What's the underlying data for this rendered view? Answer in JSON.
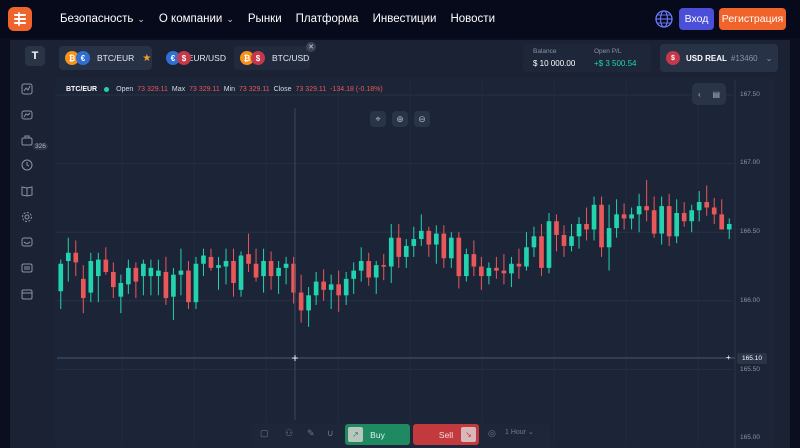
{
  "nav": {
    "items": [
      {
        "label": "Безопасность",
        "dropdown": true
      },
      {
        "label": "О компании",
        "dropdown": true
      },
      {
        "label": "Рынки",
        "dropdown": false
      },
      {
        "label": "Платформа",
        "dropdown": false
      },
      {
        "label": "Инвестиции",
        "dropdown": false
      },
      {
        "label": "Новости",
        "dropdown": false
      }
    ],
    "login_label": "Вход",
    "register_label": "Регистрация",
    "colors": {
      "accent": "#f0632a",
      "login": "#4b4fd8"
    }
  },
  "tabs": [
    {
      "label": "BTC/EUR",
      "favorite": true,
      "active": true
    },
    {
      "label": "EUR/USD",
      "favorite": false,
      "active": false
    },
    {
      "label": "BTC/USD",
      "favorite": false,
      "active": false
    }
  ],
  "account": {
    "balance_label": "Balance",
    "balance_value": "$ 10 000.00",
    "pl_label": "Open P/L",
    "pl_value": "+$ 3 500.54",
    "name": "USD REAL",
    "number": "#13460"
  },
  "sidebar": {
    "badge": "326"
  },
  "chart": {
    "symbol": "BTC/EUR",
    "open_label": "Open",
    "open": "73 329.11",
    "max_label": "Max",
    "max": "73 329.11",
    "min_label": "Min",
    "min": "73 329.11",
    "close_label": "Close",
    "close": "73 329.11",
    "change": "-134.18 (-0.18%)",
    "current_price": "165.10",
    "y_ticks": [
      "167.50",
      "167.00",
      "166.50",
      "166.00",
      "165.50",
      "165.00"
    ]
  },
  "trade": {
    "buy_label": "Buy",
    "sell_label": "Sell",
    "period": "1 Hour"
  },
  "chart_data": {
    "type": "candlestick",
    "ylim": [
      165.0,
      167.5
    ],
    "colors": {
      "up": "#22d3b0",
      "down": "#e8585a"
    },
    "candles": [
      {
        "o": 166.07,
        "h": 166.3,
        "l": 165.94,
        "c": 166.27
      },
      {
        "o": 166.29,
        "h": 166.46,
        "l": 166.14,
        "c": 166.35
      },
      {
        "o": 166.35,
        "h": 166.44,
        "l": 166.18,
        "c": 166.28
      },
      {
        "o": 166.16,
        "h": 166.26,
        "l": 165.91,
        "c": 166.02
      },
      {
        "o": 166.06,
        "h": 166.35,
        "l": 165.99,
        "c": 166.29
      },
      {
        "o": 166.18,
        "h": 166.35,
        "l": 165.99,
        "c": 166.3
      },
      {
        "o": 166.3,
        "h": 166.39,
        "l": 166.19,
        "c": 166.21
      },
      {
        "o": 166.21,
        "h": 166.28,
        "l": 166.02,
        "c": 166.1
      },
      {
        "o": 166.03,
        "h": 166.19,
        "l": 165.91,
        "c": 166.13
      },
      {
        "o": 166.12,
        "h": 166.3,
        "l": 166.05,
        "c": 166.24
      },
      {
        "o": 166.24,
        "h": 166.28,
        "l": 166.02,
        "c": 166.14
      },
      {
        "o": 166.18,
        "h": 166.3,
        "l": 166.04,
        "c": 166.27
      },
      {
        "o": 166.18,
        "h": 166.3,
        "l": 166.04,
        "c": 166.24
      },
      {
        "o": 166.18,
        "h": 166.3,
        "l": 166.04,
        "c": 166.22
      },
      {
        "o": 166.21,
        "h": 166.32,
        "l": 165.97,
        "c": 166.02
      },
      {
        "o": 166.03,
        "h": 166.24,
        "l": 165.86,
        "c": 166.19
      },
      {
        "o": 166.19,
        "h": 166.38,
        "l": 166.04,
        "c": 166.22
      },
      {
        "o": 166.22,
        "h": 166.29,
        "l": 165.94,
        "c": 165.99
      },
      {
        "o": 165.99,
        "h": 166.32,
        "l": 165.94,
        "c": 166.27
      },
      {
        "o": 166.27,
        "h": 166.38,
        "l": 166.18,
        "c": 166.33
      },
      {
        "o": 166.32,
        "h": 166.38,
        "l": 166.22,
        "c": 166.24
      },
      {
        "o": 166.24,
        "h": 166.32,
        "l": 166.08,
        "c": 166.26
      },
      {
        "o": 166.25,
        "h": 166.38,
        "l": 166.12,
        "c": 166.29
      },
      {
        "o": 166.29,
        "h": 166.38,
        "l": 166.03,
        "c": 166.13
      },
      {
        "o": 166.08,
        "h": 166.36,
        "l": 166.03,
        "c": 166.33
      },
      {
        "o": 166.34,
        "h": 166.49,
        "l": 166.21,
        "c": 166.27
      },
      {
        "o": 166.27,
        "h": 166.38,
        "l": 166.14,
        "c": 166.17
      },
      {
        "o": 166.18,
        "h": 166.38,
        "l": 166.06,
        "c": 166.29
      },
      {
        "o": 166.29,
        "h": 166.36,
        "l": 166.08,
        "c": 166.18
      },
      {
        "o": 166.18,
        "h": 166.29,
        "l": 166.05,
        "c": 166.24
      },
      {
        "o": 166.24,
        "h": 166.32,
        "l": 166.12,
        "c": 166.27
      },
      {
        "o": 166.27,
        "h": 166.32,
        "l": 165.98,
        "c": 166.06
      },
      {
        "o": 166.06,
        "h": 166.19,
        "l": 165.84,
        "c": 165.93
      },
      {
        "o": 165.93,
        "h": 166.1,
        "l": 165.81,
        "c": 166.04
      },
      {
        "o": 166.04,
        "h": 166.21,
        "l": 165.97,
        "c": 166.14
      },
      {
        "o": 166.14,
        "h": 166.23,
        "l": 166.0,
        "c": 166.08
      },
      {
        "o": 166.08,
        "h": 166.19,
        "l": 165.94,
        "c": 166.12
      },
      {
        "o": 166.12,
        "h": 166.22,
        "l": 165.92,
        "c": 166.04
      },
      {
        "o": 166.04,
        "h": 166.21,
        "l": 165.97,
        "c": 166.16
      },
      {
        "o": 166.16,
        "h": 166.28,
        "l": 166.05,
        "c": 166.22
      },
      {
        "o": 166.22,
        "h": 166.39,
        "l": 166.14,
        "c": 166.29
      },
      {
        "o": 166.29,
        "h": 166.35,
        "l": 166.11,
        "c": 166.17
      },
      {
        "o": 166.17,
        "h": 166.29,
        "l": 166.05,
        "c": 166.26
      },
      {
        "o": 166.26,
        "h": 166.34,
        "l": 166.15,
        "c": 166.25
      },
      {
        "o": 166.25,
        "h": 166.56,
        "l": 166.13,
        "c": 166.46
      },
      {
        "o": 166.46,
        "h": 166.56,
        "l": 166.24,
        "c": 166.32
      },
      {
        "o": 166.32,
        "h": 166.45,
        "l": 166.24,
        "c": 166.4
      },
      {
        "o": 166.4,
        "h": 166.54,
        "l": 166.32,
        "c": 166.45
      },
      {
        "o": 166.45,
        "h": 166.63,
        "l": 166.4,
        "c": 166.51
      },
      {
        "o": 166.51,
        "h": 166.54,
        "l": 166.32,
        "c": 166.41
      },
      {
        "o": 166.41,
        "h": 166.55,
        "l": 166.27,
        "c": 166.49
      },
      {
        "o": 166.49,
        "h": 166.55,
        "l": 166.24,
        "c": 166.31
      },
      {
        "o": 166.31,
        "h": 166.5,
        "l": 166.24,
        "c": 166.46
      },
      {
        "o": 166.46,
        "h": 166.5,
        "l": 166.09,
        "c": 166.18
      },
      {
        "o": 166.18,
        "h": 166.38,
        "l": 166.14,
        "c": 166.34
      },
      {
        "o": 166.34,
        "h": 166.44,
        "l": 166.18,
        "c": 166.25
      },
      {
        "o": 166.25,
        "h": 166.32,
        "l": 166.08,
        "c": 166.18
      },
      {
        "o": 166.18,
        "h": 166.28,
        "l": 166.12,
        "c": 166.24
      },
      {
        "o": 166.24,
        "h": 166.32,
        "l": 166.16,
        "c": 166.22
      },
      {
        "o": 166.22,
        "h": 166.34,
        "l": 166.12,
        "c": 166.2
      },
      {
        "o": 166.2,
        "h": 166.32,
        "l": 166.1,
        "c": 166.27
      },
      {
        "o": 166.27,
        "h": 166.38,
        "l": 166.16,
        "c": 166.25
      },
      {
        "o": 166.25,
        "h": 166.5,
        "l": 166.22,
        "c": 166.39
      },
      {
        "o": 166.39,
        "h": 166.54,
        "l": 166.32,
        "c": 166.47
      },
      {
        "o": 166.47,
        "h": 166.56,
        "l": 166.18,
        "c": 166.24
      },
      {
        "o": 166.24,
        "h": 166.64,
        "l": 166.2,
        "c": 166.58
      },
      {
        "o": 166.58,
        "h": 166.63,
        "l": 166.36,
        "c": 166.48
      },
      {
        "o": 166.48,
        "h": 166.55,
        "l": 166.32,
        "c": 166.4
      },
      {
        "o": 166.4,
        "h": 166.56,
        "l": 166.36,
        "c": 166.47
      },
      {
        "o": 166.47,
        "h": 166.61,
        "l": 166.38,
        "c": 166.56
      },
      {
        "o": 166.56,
        "h": 166.68,
        "l": 166.44,
        "c": 166.52
      },
      {
        "o": 166.52,
        "h": 166.76,
        "l": 166.44,
        "c": 166.7
      },
      {
        "o": 166.7,
        "h": 166.76,
        "l": 166.32,
        "c": 166.39
      },
      {
        "o": 166.39,
        "h": 166.7,
        "l": 166.22,
        "c": 166.53
      },
      {
        "o": 166.53,
        "h": 166.74,
        "l": 166.46,
        "c": 166.63
      },
      {
        "o": 166.63,
        "h": 166.71,
        "l": 166.52,
        "c": 166.6
      },
      {
        "o": 166.6,
        "h": 166.68,
        "l": 166.52,
        "c": 166.63
      },
      {
        "o": 166.63,
        "h": 166.78,
        "l": 166.5,
        "c": 166.69
      },
      {
        "o": 166.69,
        "h": 166.88,
        "l": 166.58,
        "c": 166.66
      },
      {
        "o": 166.66,
        "h": 166.76,
        "l": 166.46,
        "c": 166.49
      },
      {
        "o": 166.49,
        "h": 166.76,
        "l": 166.41,
        "c": 166.69
      },
      {
        "o": 166.69,
        "h": 166.78,
        "l": 166.4,
        "c": 166.47
      },
      {
        "o": 166.47,
        "h": 166.74,
        "l": 166.42,
        "c": 166.64
      },
      {
        "o": 166.64,
        "h": 166.72,
        "l": 166.54,
        "c": 166.58
      },
      {
        "o": 166.58,
        "h": 166.7,
        "l": 166.5,
        "c": 166.66
      },
      {
        "o": 166.66,
        "h": 166.8,
        "l": 166.58,
        "c": 166.72
      },
      {
        "o": 166.72,
        "h": 166.84,
        "l": 166.62,
        "c": 166.68
      },
      {
        "o": 166.68,
        "h": 166.75,
        "l": 166.56,
        "c": 166.63
      },
      {
        "o": 166.63,
        "h": 166.74,
        "l": 166.52,
        "c": 166.52
      },
      {
        "o": 166.52,
        "h": 166.6,
        "l": 166.45,
        "c": 166.56
      }
    ]
  }
}
